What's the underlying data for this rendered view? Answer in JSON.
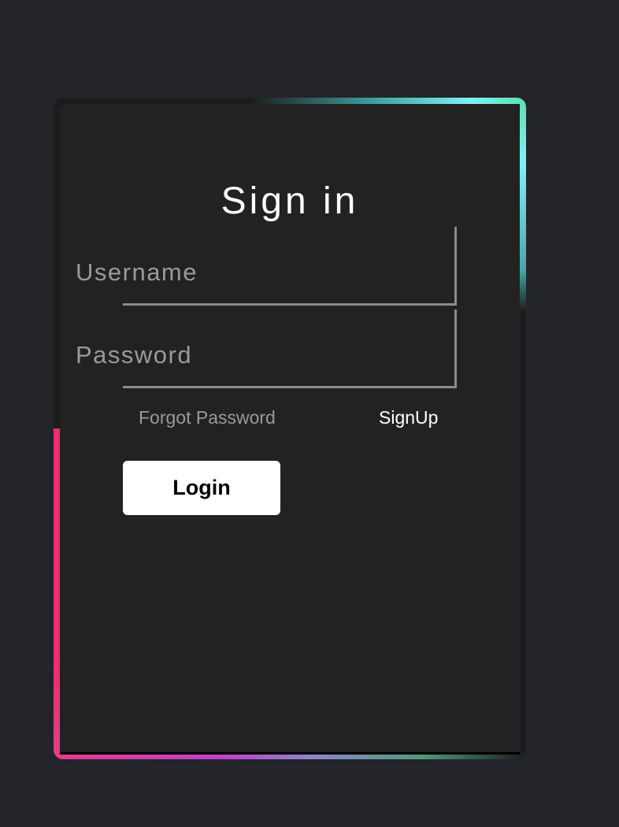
{
  "form": {
    "title": "Sign in",
    "username_label": "Username",
    "password_label": "Password",
    "forgot_link": "Forgot Password",
    "signup_link": "SignUp",
    "login_button": "Login"
  },
  "colors": {
    "background": "#23242a",
    "card": "#222222",
    "glow_teal": "#7ff3f3",
    "glow_green": "#59e0b0",
    "glow_pink": "#ea2f6a",
    "glow_purple": "#c040c8"
  }
}
